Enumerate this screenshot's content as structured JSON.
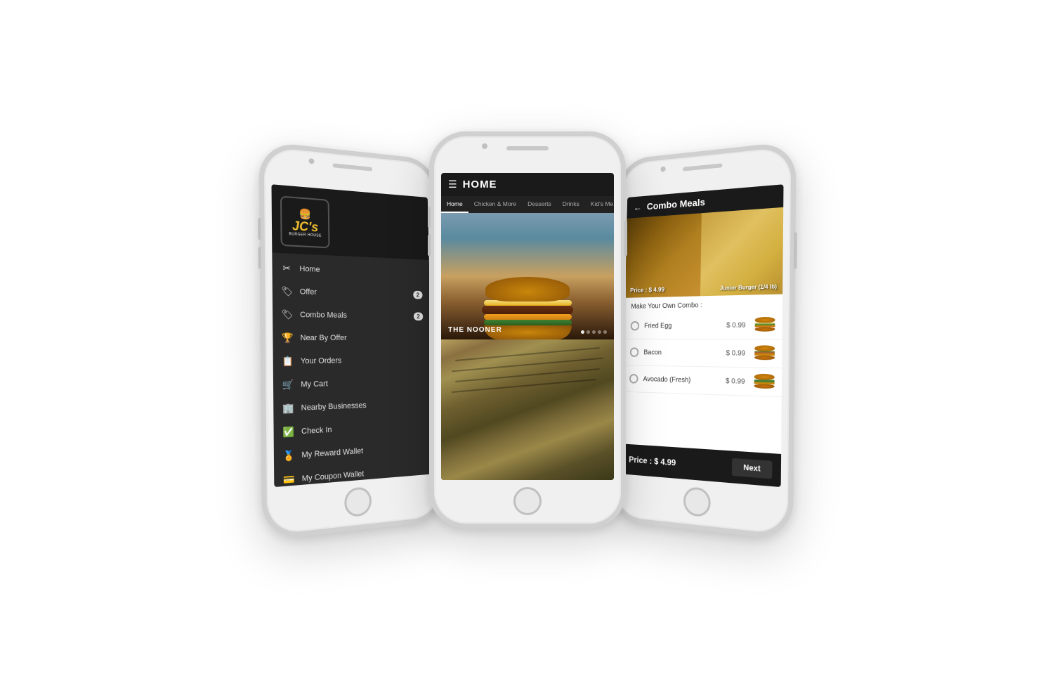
{
  "phones": {
    "left": {
      "screen": "menu",
      "logo": {
        "brand": "JC's",
        "sub": "BURGER HOUSE"
      },
      "menu_items": [
        {
          "id": "home",
          "label": "Home",
          "icon": "✂",
          "badge": null
        },
        {
          "id": "offer",
          "label": "Offer",
          "icon": "🏷",
          "badge": "2"
        },
        {
          "id": "combo-meals",
          "label": "Combo Meals",
          "icon": "🏷",
          "badge": "2"
        },
        {
          "id": "nearby-offer",
          "label": "Near By Offer",
          "icon": "🏆",
          "badge": null
        },
        {
          "id": "your-orders",
          "label": "Your Orders",
          "icon": "📋",
          "badge": null
        },
        {
          "id": "my-cart",
          "label": "My Cart",
          "icon": "🛒",
          "badge": null
        },
        {
          "id": "nearby-businesses",
          "label": "Nearby Businesses",
          "icon": "🏢",
          "badge": null
        },
        {
          "id": "check-in",
          "label": "Check In",
          "icon": "✅",
          "badge": null
        },
        {
          "id": "reward-wallet",
          "label": "My Reward Wallet",
          "icon": "🏅",
          "badge": null
        },
        {
          "id": "coupon-wallet",
          "label": "My Coupon Wallet",
          "icon": "💳",
          "badge": null
        }
      ]
    },
    "center": {
      "screen": "home",
      "header_title": "HOME",
      "nav_tabs": [
        "Home",
        "Chicken & More",
        "Desserts",
        "Drinks",
        "Kid's Me..."
      ],
      "active_tab": "Home",
      "hero_label": "THE NOONER",
      "dots": 5,
      "active_dot": 0
    },
    "right": {
      "screen": "combo-meals",
      "header_title": "Combo Meals",
      "food_price": "Price : $ 4.99",
      "food_name": "Junior Burger (1/4 lb)",
      "make_combo_label": "Make Your Own Combo :",
      "options": [
        {
          "name": "Fried Egg",
          "price": "$ 0.99"
        },
        {
          "name": "Bacon",
          "price": "$ 0.99"
        },
        {
          "name": "Avocado (Fresh)",
          "price": "$ 0.99"
        }
      ],
      "footer_price": "Price : $ 4.99",
      "next_button": "Next"
    }
  }
}
